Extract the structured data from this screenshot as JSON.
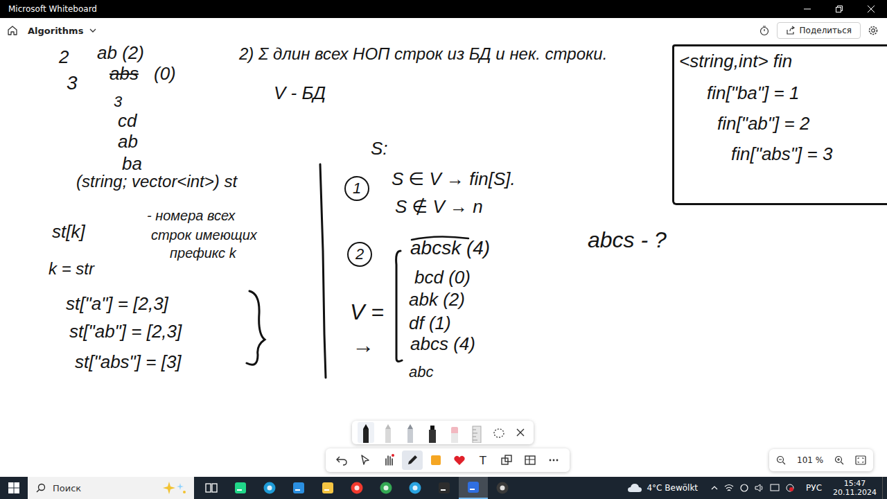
{
  "window": {
    "title": "Microsoft Whiteboard"
  },
  "app_bar": {
    "board_name": "Algorithms",
    "share_button": "Поделиться"
  },
  "canvas": {
    "notes": [
      {
        "text": "2",
        "kind": "text"
      },
      {
        "text": "ab (2)",
        "kind": "text"
      },
      {
        "text": "3",
        "kind": "text"
      },
      {
        "text": "abs",
        "kind": "struck"
      },
      {
        "text": "(0)",
        "kind": "text"
      },
      {
        "text": "3",
        "kind": "text"
      },
      {
        "text": "cd",
        "kind": "text"
      },
      {
        "text": "ab",
        "kind": "text"
      },
      {
        "text": "ba",
        "kind": "text"
      },
      {
        "text": "2) Σ длин всех НОП строк из БД и нек. строки.",
        "kind": "text"
      },
      {
        "text": "V - БД",
        "kind": "text"
      },
      {
        "text": "S:",
        "kind": "text"
      },
      {
        "text": "(string; vector<int>) st",
        "kind": "text"
      },
      {
        "text": "st[k]",
        "kind": "text"
      },
      {
        "text": "- номера всех",
        "kind": "text"
      },
      {
        "text": "строк имеющих",
        "kind": "text"
      },
      {
        "text": "префикс k",
        "kind": "text"
      },
      {
        "text": "k = str",
        "kind": "text"
      },
      {
        "text": "st[\"a\"] = [2,3]",
        "kind": "text"
      },
      {
        "text": "st[\"ab\"] = [2,3]",
        "kind": "text"
      },
      {
        "text": "st[\"abs\"] = [3]",
        "kind": "text"
      },
      {
        "text": "1",
        "kind": "circled"
      },
      {
        "text": "S ∈ V → fin[S].",
        "kind": "text"
      },
      {
        "text": "S ∉ V → n",
        "kind": "text"
      },
      {
        "text": "2",
        "kind": "circled"
      },
      {
        "text": "abcsk (4)",
        "kind": "text"
      },
      {
        "text": "bcd (0)",
        "kind": "text"
      },
      {
        "text": "abk (2)",
        "kind": "text"
      },
      {
        "text": "df (1)",
        "kind": "text"
      },
      {
        "text": "abcs (4)",
        "kind": "text"
      },
      {
        "text": "abc",
        "kind": "text"
      },
      {
        "text": "V =",
        "kind": "text"
      },
      {
        "text": "→",
        "kind": "text"
      },
      {
        "text": "abcs - ?",
        "kind": "text"
      },
      {
        "text": "<string,int> fin",
        "kind": "text"
      },
      {
        "text": "fin[\"ba\"] = 1",
        "kind": "text"
      },
      {
        "text": "fin[\"ab\"] = 2",
        "kind": "text"
      },
      {
        "text": "fin[\"abs\"] = 3",
        "kind": "text"
      }
    ]
  },
  "pen_tray": {
    "tools": [
      {
        "kind": "pen",
        "selected": true
      },
      {
        "kind": "pencil",
        "selected": false
      },
      {
        "kind": "silver",
        "selected": false
      },
      {
        "kind": "marker",
        "selected": false
      },
      {
        "kind": "eraser",
        "selected": false
      },
      {
        "kind": "ruler",
        "selected": false
      },
      {
        "kind": "lasso",
        "selected": false
      }
    ]
  },
  "toolbar": {
    "tools": [
      {
        "kind": "undo",
        "selected": false
      },
      {
        "kind": "select",
        "selected": false
      },
      {
        "kind": "hand",
        "selected": false
      },
      {
        "kind": "pen",
        "selected": true
      },
      {
        "kind": "note",
        "selected": false
      },
      {
        "kind": "reaction",
        "selected": false
      },
      {
        "kind": "text",
        "selected": false,
        "label": "T"
      },
      {
        "kind": "shapes",
        "selected": false
      },
      {
        "kind": "table",
        "selected": false
      },
      {
        "kind": "more",
        "selected": false
      }
    ]
  },
  "zoom": {
    "level": "101 %"
  },
  "taskbar": {
    "search_placeholder": "Поиск",
    "apps": [
      {
        "kind": "taskview",
        "selected": false
      },
      {
        "kind": "pycharm",
        "selected": false
      },
      {
        "kind": "edge",
        "selected": false
      },
      {
        "kind": "vscode",
        "selected": false
      },
      {
        "kind": "explorer",
        "selected": false
      },
      {
        "kind": "yandex",
        "selected": false
      },
      {
        "kind": "chrome",
        "selected": false
      },
      {
        "kind": "telegram",
        "selected": false
      },
      {
        "kind": "terminal",
        "selected": false
      },
      {
        "kind": "whiteboard",
        "selected": true
      },
      {
        "kind": "obs",
        "selected": false
      }
    ],
    "weather": "4°C Bewölkt",
    "language": "РУС",
    "time": "15:47",
    "date": "20.11.2024"
  }
}
